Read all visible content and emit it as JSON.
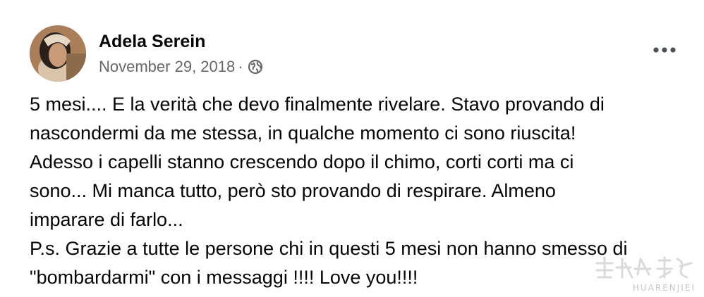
{
  "post": {
    "author": "Adela Serein",
    "date": "November 29, 2018",
    "separator": "·",
    "privacy_icon": "globe-icon",
    "more_icon": "more-horizontal-icon",
    "lines": [
      "5 mesi.... E la verità che devo finalmente rivelare. Stavo provando di",
      "nascondermi da me stessa, in qualche momento ci sono riuscita!",
      "Adesso i capelli stanno crescendo dopo il chimo, corti corti ma ci",
      "sono... Mi manca tutto, però sto provando di respirare. Almeno",
      "imparare di farlo...",
      "P.s. Grazie a tutte le persone chi in questi 5 mesi non hanno smesso di",
      "\"bombardarmi\" con i messaggi !!!! Love you!!!!"
    ]
  },
  "watermark": {
    "text": "HUARENJIEI"
  },
  "colors": {
    "text_primary": "#050505",
    "text_secondary": "#65676b",
    "background": "#ffffff"
  }
}
